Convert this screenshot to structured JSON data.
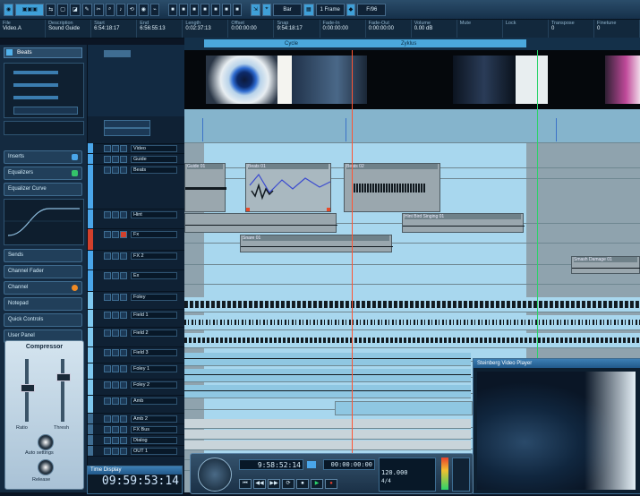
{
  "toolbar": {
    "tools": [
      "▢",
      "◪",
      "✎",
      "✂",
      "⌕",
      "♪",
      "⟲",
      "◉",
      "⌁"
    ],
    "transport_mini": [
      "■",
      "■",
      "■",
      "■",
      "■",
      "■",
      "■"
    ],
    "dropdown_1": "Bar",
    "dropdown_2": "1 Frame",
    "dropdown_3": "F/96"
  },
  "infoline": [
    {
      "h": "File",
      "v": "Video.A"
    },
    {
      "h": "Description",
      "v": "Sound Guide"
    },
    {
      "h": "Start",
      "v": "6:54:18:17"
    },
    {
      "h": "End",
      "v": "6:56:55:13"
    },
    {
      "h": "Length",
      "v": "0:02:37:13"
    },
    {
      "h": "Offset",
      "v": "0:00:00:00"
    },
    {
      "h": "Snap",
      "v": "9:54:18:17"
    },
    {
      "h": "Fade-In",
      "v": "0:00:00:00"
    },
    {
      "h": "Fade-Out",
      "v": "0:00:00:00"
    },
    {
      "h": "Volume",
      "v": "0.00 dB"
    },
    {
      "h": "Mute",
      "v": ""
    },
    {
      "h": "Lock",
      "v": ""
    },
    {
      "h": "Transpose",
      "v": "0"
    },
    {
      "h": "Finetune",
      "v": "0"
    }
  ],
  "ruler": {
    "labels": [
      "Cycle",
      "Zyklus"
    ]
  },
  "inspector": {
    "track_name": "Beats",
    "sections": [
      "Inserts",
      "Equalizers",
      "Equalizer Curve",
      "Sends",
      "Channel Fader",
      "Channel",
      "Notepad",
      "Quick Controls",
      "User Panel"
    ],
    "compressor_title": "Compressor",
    "knob_labels": [
      "Ratio",
      "Thresh",
      "Auto settings",
      "Release"
    ]
  },
  "tracks": [
    {
      "name": "Video"
    },
    {
      "name": "Guide"
    },
    {
      "name": "Beats"
    },
    {
      "name": "Hint"
    },
    {
      "name": "Fx"
    },
    {
      "name": "FX 2"
    },
    {
      "name": "Ex"
    },
    {
      "name": "Foley"
    },
    {
      "name": "Field 1"
    },
    {
      "name": "Field 2"
    },
    {
      "name": "Field 3"
    },
    {
      "name": "Foley 1"
    },
    {
      "name": "Foley 2"
    },
    {
      "name": "Amb"
    },
    {
      "name": "Amb 2"
    },
    {
      "name": "FX Bus"
    },
    {
      "name": "Dialog"
    },
    {
      "name": "OUT 1"
    }
  ],
  "clips": {
    "guide_1": "Guide 01",
    "beats_1": "Beats 01",
    "beats_2": "Beats 02",
    "hint_1": "Hint Bird Singing 01",
    "fx_1": "Snare 01",
    "fx_2": "Smash Damage 01"
  },
  "video_player": {
    "title": "Steinberg Video Player"
  },
  "time_display": {
    "title": "Time Display",
    "value": "09:59:53:14"
  },
  "transport": {
    "position": "9:58:52:14",
    "second_position": "00:00:00:00",
    "tempo": "120.000",
    "signature": "4/4",
    "buttons": [
      "⏮",
      "◀◀",
      "▶▶",
      "⏹",
      "▶",
      "●",
      "⟳"
    ]
  },
  "colors": {
    "accent": "#3fa0d8",
    "cycle": "#a8d7ee",
    "playhead": "#ff5533",
    "cursor": "#2bd36a"
  }
}
